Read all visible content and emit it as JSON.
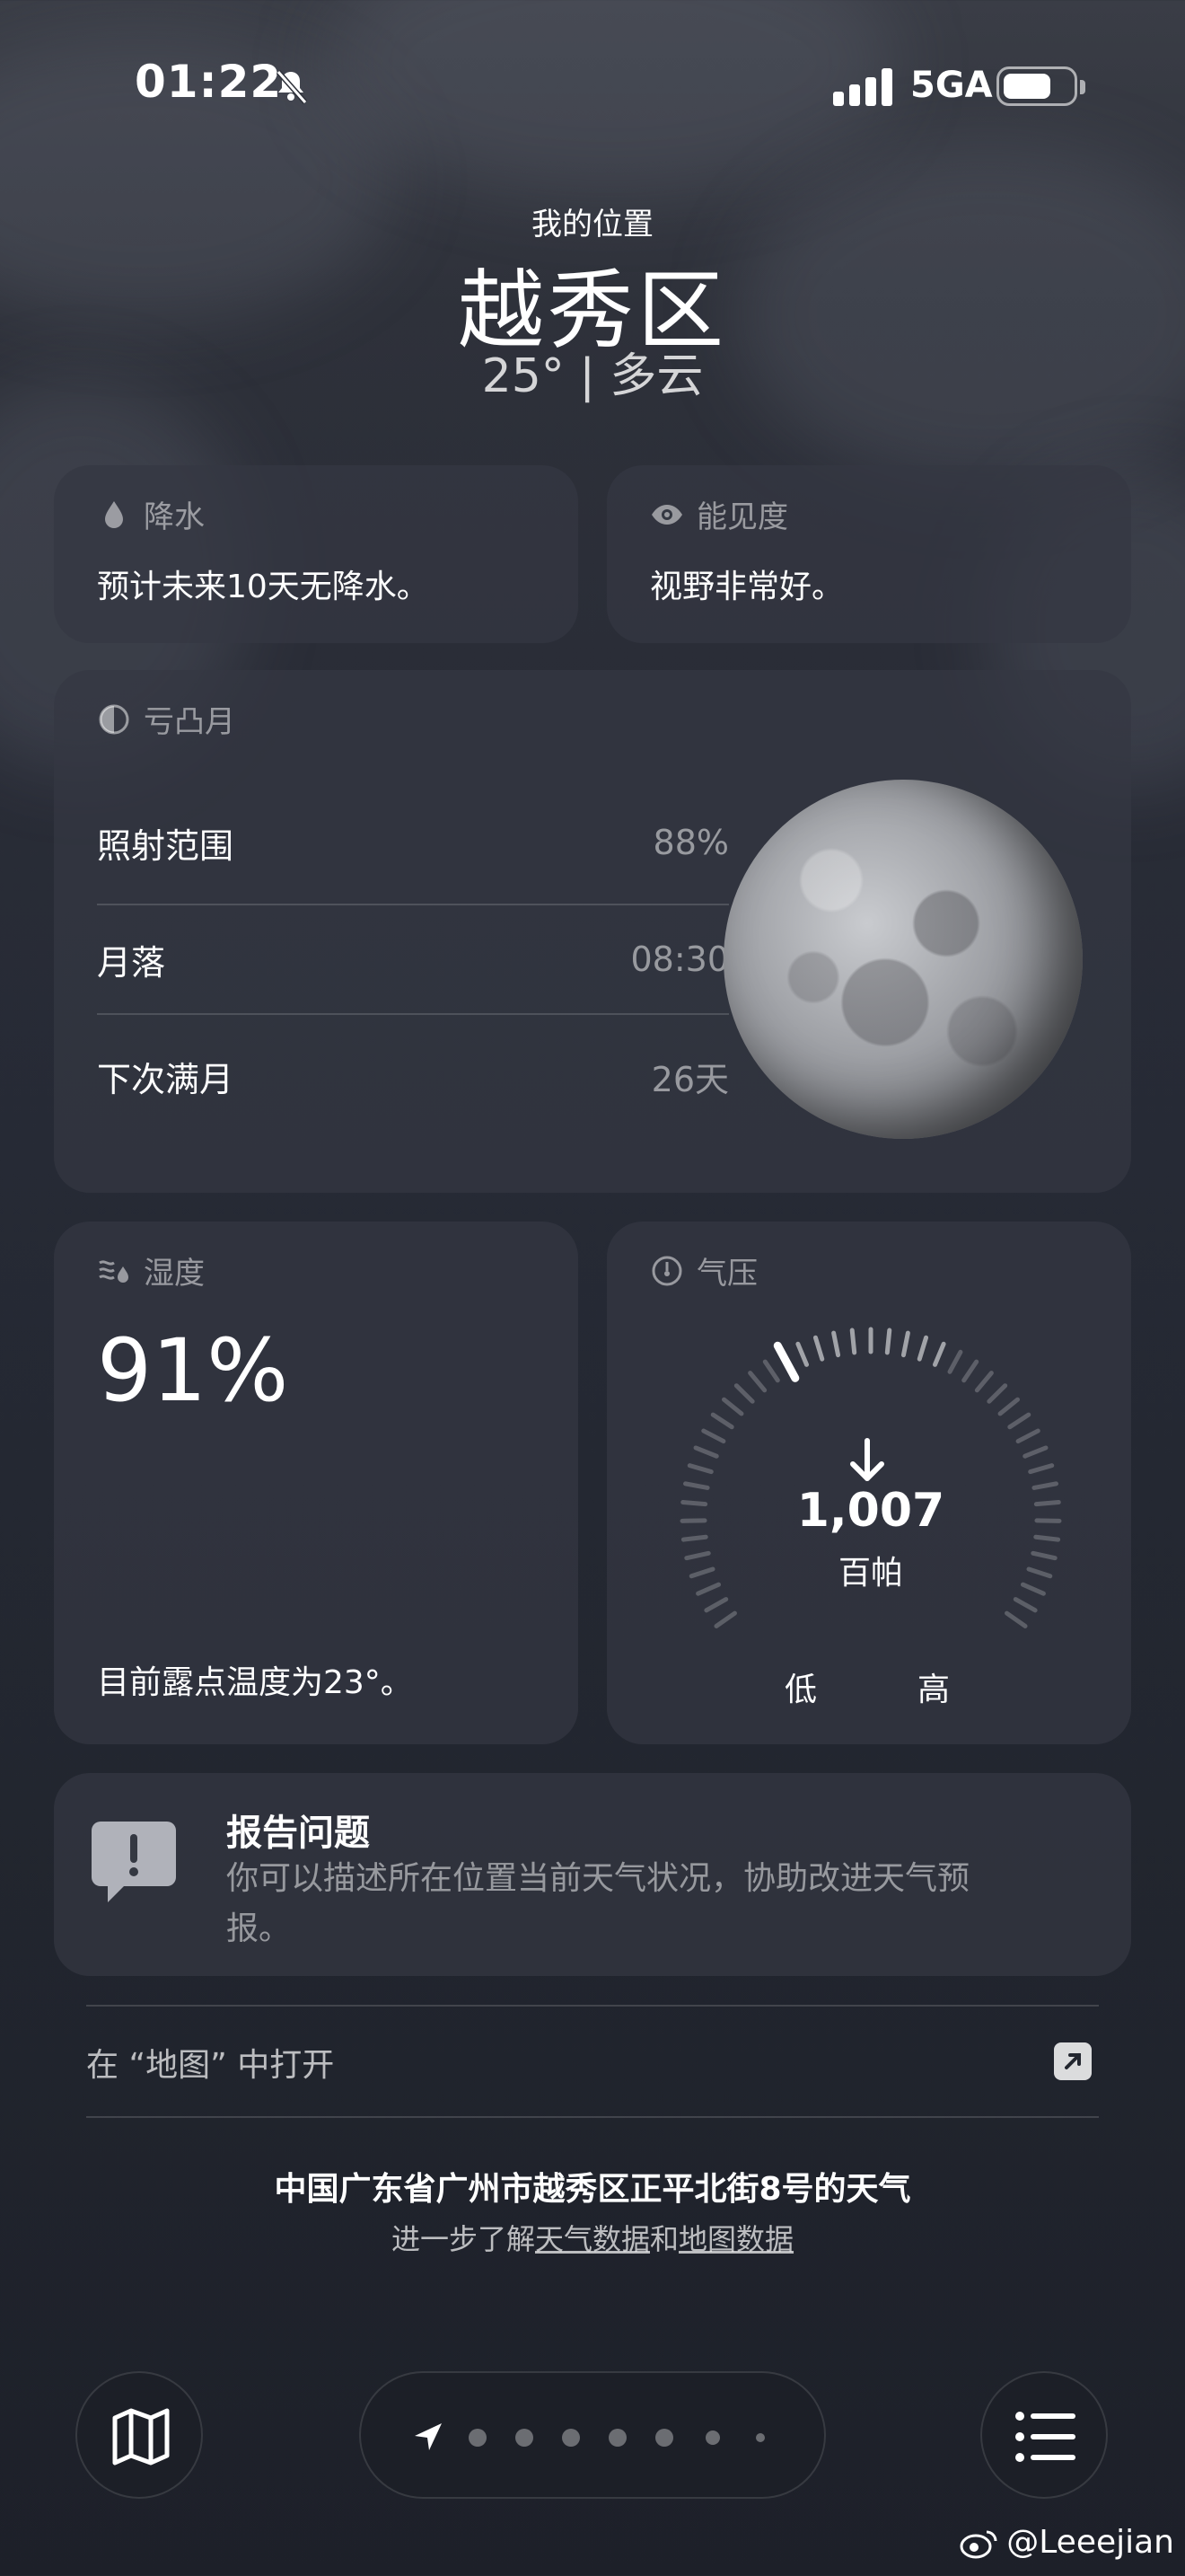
{
  "status_bar": {
    "time": "01:22",
    "network": "5GA"
  },
  "header": {
    "location_label": "我的位置",
    "city": "越秀区",
    "summary": "25°  |  多云"
  },
  "precipitation": {
    "title": "降水",
    "text": "预计未来10天无降水。"
  },
  "visibility": {
    "title": "能见度",
    "text": "视野非常好。"
  },
  "moon": {
    "title": "亏凸月",
    "rows": [
      {
        "label": "照射范围",
        "value": "88%"
      },
      {
        "label": "月落",
        "value": "08:30"
      },
      {
        "label": "下次满月",
        "value": "26天"
      }
    ]
  },
  "humidity": {
    "title": "湿度",
    "value": "91%",
    "dew_point": "目前露点温度为23°。"
  },
  "pressure": {
    "title": "气压",
    "value": "1,007",
    "unit": "百帕",
    "low": "低",
    "high": "高",
    "trend": "falling"
  },
  "report": {
    "title": "报告问题",
    "body": "你可以描述所在位置当前天气状况，协助改进天气预报。"
  },
  "map_link": {
    "label": "在 “地图” 中打开"
  },
  "footer": {
    "address": "中国广东省广州市越秀区正平北街8号的天气",
    "learn_prefix": "进一步了解",
    "weather_data": "天气数据",
    "and": "和",
    "map_data": "地图数据"
  },
  "watermark": "@Leeejian",
  "colors": {
    "card_bg": "#343842",
    "background": "#262a35"
  }
}
